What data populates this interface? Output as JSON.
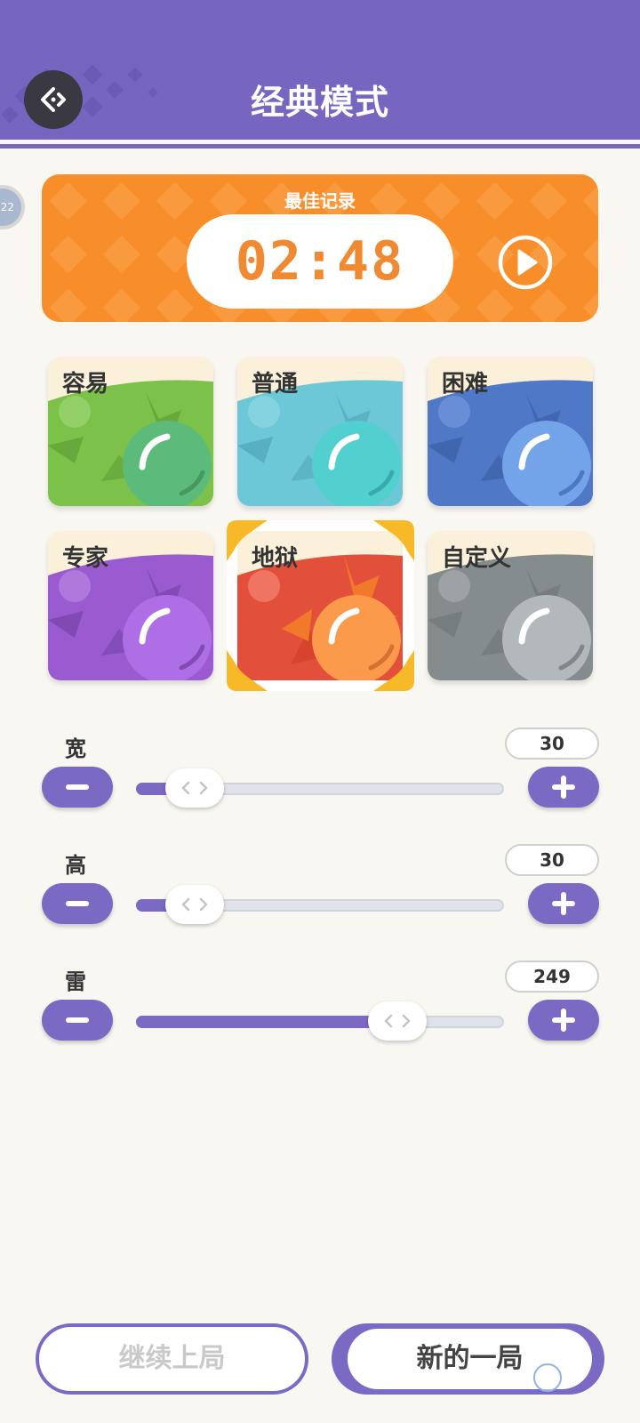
{
  "header": {
    "title": "经典模式",
    "back_icon": "back-diamond-icon",
    "background_color": "#7766c0"
  },
  "side_badge": {
    "text": "22"
  },
  "best_record": {
    "label": "最佳记录",
    "time": "02:48",
    "play_icon": "play-circle-icon",
    "background_color": "#f88e2a"
  },
  "difficulties": [
    {
      "label": "容易",
      "color": "#7bc14a",
      "selected": false
    },
    {
      "label": "普通",
      "color": "#6cc7d6",
      "selected": false
    },
    {
      "label": "困难",
      "color": "#4f78c6",
      "selected": false
    },
    {
      "label": "专家",
      "color": "#9a5bd0",
      "selected": false
    },
    {
      "label": "地狱",
      "color": "#e2503c",
      "selected": true
    },
    {
      "label": "自定义",
      "color": "#858c8e",
      "selected": false
    }
  ],
  "settings": {
    "width": {
      "label": "宽",
      "value": "30",
      "level": 0.16
    },
    "height": {
      "label": "高",
      "value": "30",
      "level": 0.16
    },
    "mines": {
      "label": "雷",
      "value": "249",
      "level": 0.71
    }
  },
  "buttons": {
    "continue_label": "继续上局",
    "new_game_label": "新的一局"
  },
  "accent_color": "#7b6ac4"
}
